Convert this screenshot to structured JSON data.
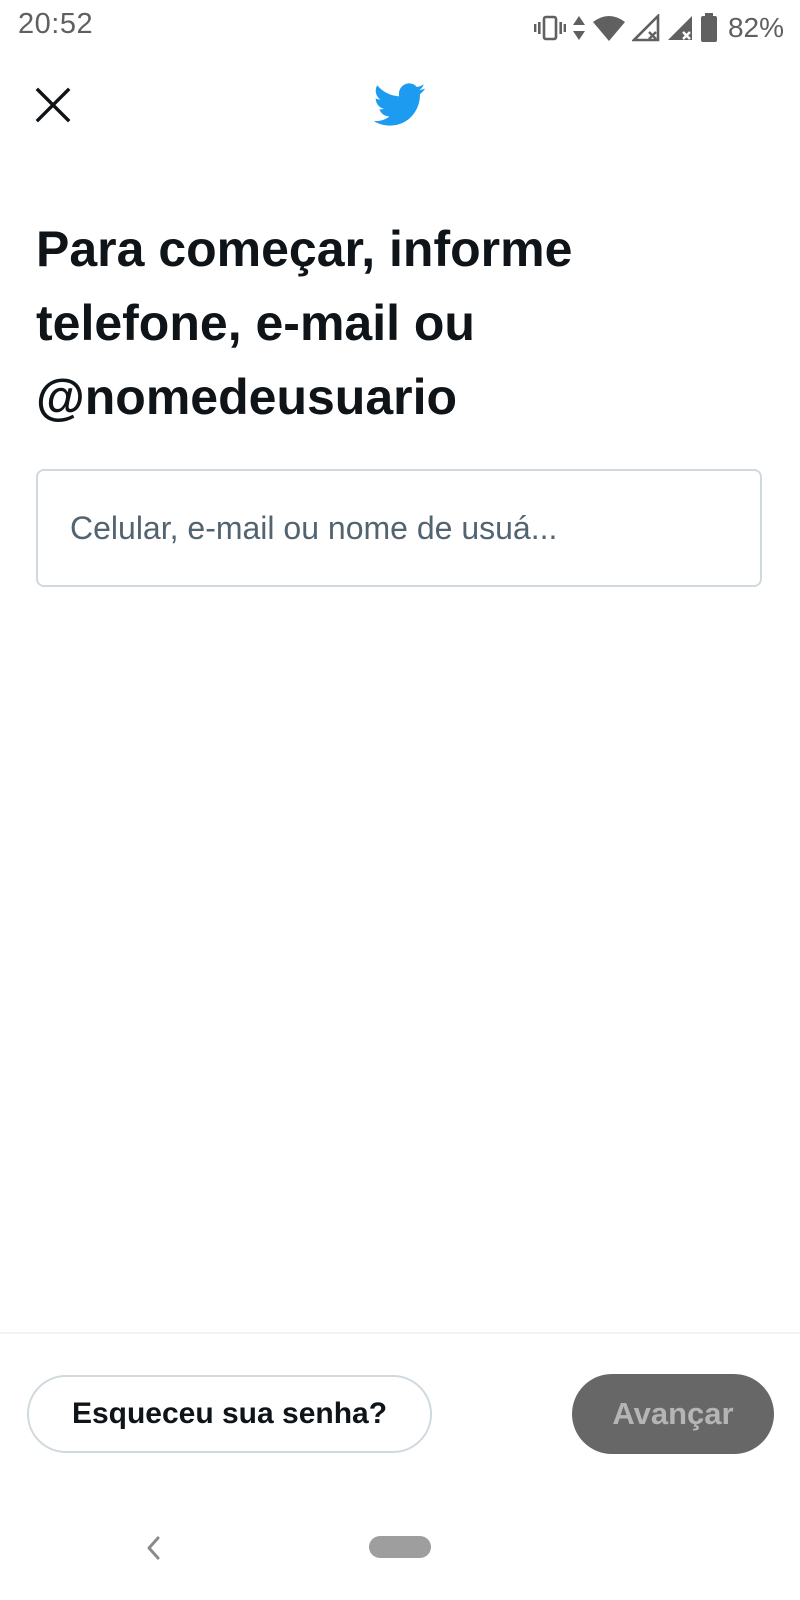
{
  "status_bar": {
    "time": "20:52",
    "battery": "82%",
    "icons": [
      "vibrate-icon",
      "data-arrows-icon",
      "wifi-icon",
      "signal-icon",
      "signal-icon",
      "battery-icon"
    ]
  },
  "header": {
    "close_icon": "close-icon",
    "logo_icon": "twitter-bird-icon"
  },
  "main": {
    "title": "Para começar, informe telefone, e-mail ou @nomedeusuario",
    "input": {
      "value": "",
      "placeholder": "Celular, e-mail ou nome de usuá..."
    }
  },
  "footer": {
    "forgot_label": "Esqueceu sua senha?",
    "next_label": "Avançar"
  },
  "colors": {
    "brand": "#1d9bf0",
    "text": "#0f1419",
    "placeholder": "#536471",
    "disabled_button": "#676767"
  }
}
